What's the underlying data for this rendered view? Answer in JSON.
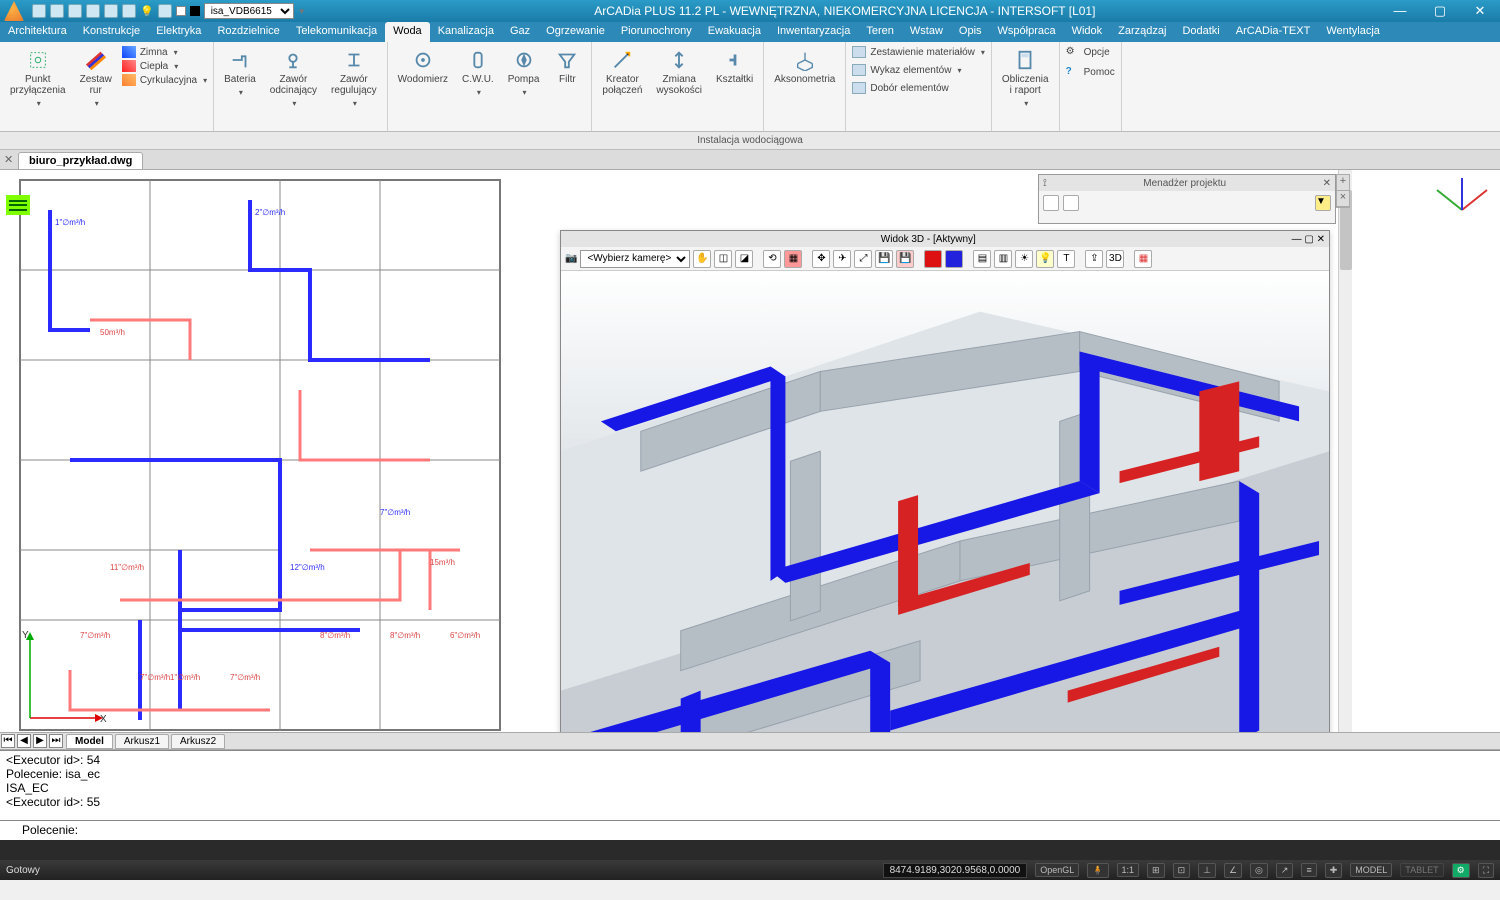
{
  "app_title": "ArCADia PLUS 11.2 PL - WEWNĘTRZNA, NIEKOMERCYJNA LICENCJA - INTERSOFT [L01]",
  "layer_select": "isa_VDB6615",
  "menu": [
    "Architektura",
    "Konstrukcje",
    "Elektryka",
    "Rozdzielnice",
    "Telekomunikacja",
    "Woda",
    "Kanalizacja",
    "Gaz",
    "Ogrzewanie",
    "Piorunochrony",
    "Ewakuacja",
    "Inwentaryzacja",
    "Teren",
    "Wstaw",
    "Opis",
    "Współpraca",
    "Widok",
    "Zarządzaj",
    "Dodatki",
    "ArCADia-TEXT",
    "Wentylacja"
  ],
  "menu_active": 5,
  "ribbon": {
    "group1": {
      "punkt": "Punkt\nprzyłączenia",
      "zestaw": "Zestaw\nrur",
      "pipes": [
        {
          "label": "Zimna",
          "color": "#1040ff"
        },
        {
          "label": "Ciepła",
          "color": "#ff2020"
        },
        {
          "label": "Cyrkulacyjna",
          "color": "#ff8030"
        }
      ]
    },
    "group2": {
      "bateria": "Bateria",
      "zawor_odcinajacy": "Zawór\nodcinający",
      "zawor_regulujacy": "Zawór\nregulujący"
    },
    "group3": {
      "wodomierz": "Wodomierz",
      "cwu": "C.W.U.",
      "pompa": "Pompa",
      "filtr": "Filtr"
    },
    "group4": {
      "kreator": "Kreator\npołączeń",
      "zmiana": "Zmiana\nwysokości",
      "ksztaltki": "Kształtki"
    },
    "group5": {
      "aksono": "Aksonometria"
    },
    "group6": {
      "zest_mat": "Zestawienie materiałów",
      "wykaz": "Wykaz elementów",
      "dobor": "Dobór elementów"
    },
    "group7": {
      "obliczenia": "Obliczenia\ni raport"
    },
    "group8": {
      "opcje": "Opcje",
      "pomoc": "Pomoc"
    },
    "footer": "Instalacja wodociągowa"
  },
  "doc_tab": "biuro_przykład.dwg",
  "proj_mgr": {
    "title": "Menadżer projektu"
  },
  "view3d": {
    "title": "Widok 3D - [Aktywny]",
    "camera": "<Wybierz kamerę>"
  },
  "sheet_tabs": {
    "model": "Model",
    "sheets": [
      "Arkusz1",
      "Arkusz2"
    ]
  },
  "cmdlines": [
    "<Executor id>: 54",
    "Polecenie: isa_ec",
    "ISA_EC",
    "<Executor id>: 55"
  ],
  "prompt": "Polecenie:",
  "status": {
    "ready": "Gotowy",
    "coords": "8474.9189,3020.9568,0.0000",
    "opengl": "OpenGL",
    "scale": "1:1",
    "model": "MODEL",
    "tablet": "TABLET"
  }
}
